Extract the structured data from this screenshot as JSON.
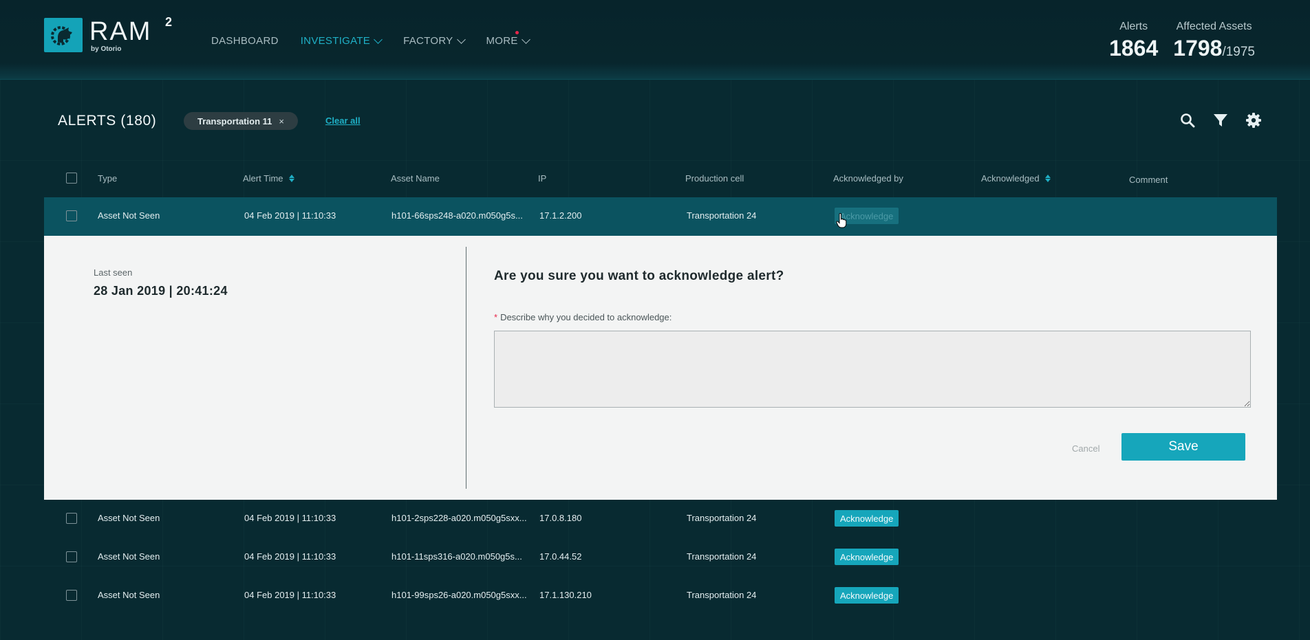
{
  "header": {
    "logo": {
      "name": "RAM",
      "superscript": "2",
      "byline": "by Otorio"
    },
    "nav": [
      {
        "label": "DASHBOARD"
      },
      {
        "label": "INVESTIGATE"
      },
      {
        "label": "FACTORY"
      },
      {
        "label": "MORE"
      }
    ],
    "stats": {
      "alerts_label": "Alerts",
      "alerts_value": "1864",
      "assets_label": "Affected Assets",
      "assets_value": "1798",
      "assets_total": "/1975"
    }
  },
  "page": {
    "title": "ALERTS (180)",
    "filter_chip": "Transportation 11",
    "chip_close": "×",
    "clear_all": "Clear all"
  },
  "table": {
    "headers": {
      "type": "Type",
      "alert_time": "Alert Time",
      "asset_name": "Asset Name",
      "ip": "IP",
      "production_cell": "Production cell",
      "acknowledged_by": "Acknowledged by",
      "acknowledged": "Acknowledged",
      "comment": "Comment"
    },
    "rows": [
      {
        "type": "Asset Not Seen",
        "time": "04 Feb 2019 | 11:10:33",
        "asset": "h101-66sps248-a020.m050g5s...",
        "ip": "17.1.2.200",
        "cell": "Transportation 24",
        "ack": "Acknowledge"
      },
      {
        "type": "Asset Not Seen",
        "time": "04 Feb 2019 | 11:10:33",
        "asset": "h101-2sps228-a020.m050g5sxx...",
        "ip": "17.0.8.180",
        "cell": "Transportation 24",
        "ack": "Acknowledge"
      },
      {
        "type": "Asset Not Seen",
        "time": "04 Feb 2019 | 11:10:33",
        "asset": "h101-11sps316-a020.m050g5s...",
        "ip": "17.0.44.52",
        "cell": "Transportation 24",
        "ack": "Acknowledge"
      },
      {
        "type": "Asset Not Seen",
        "time": "04 Feb 2019 | 11:10:33",
        "asset": "h101-99sps26-a020.m050g5sxx...",
        "ip": "17.1.130.210",
        "cell": "Transportation 24",
        "ack": "Acknowledge"
      }
    ]
  },
  "panel": {
    "last_seen_label": "Last seen",
    "last_seen_value": "28 Jan 2019 | 20:41:24",
    "question": "Are you sure you want to acknowledge alert?",
    "required_mark": "*",
    "describe_label": "Describe why you decided to acknowledge:",
    "comment_value": "",
    "cancel": "Cancel",
    "save": "Save"
  },
  "colors": {
    "accent": "#16a6bb",
    "background": "#061f26",
    "selected_row": "#0b5360",
    "required": "#e8264a"
  }
}
